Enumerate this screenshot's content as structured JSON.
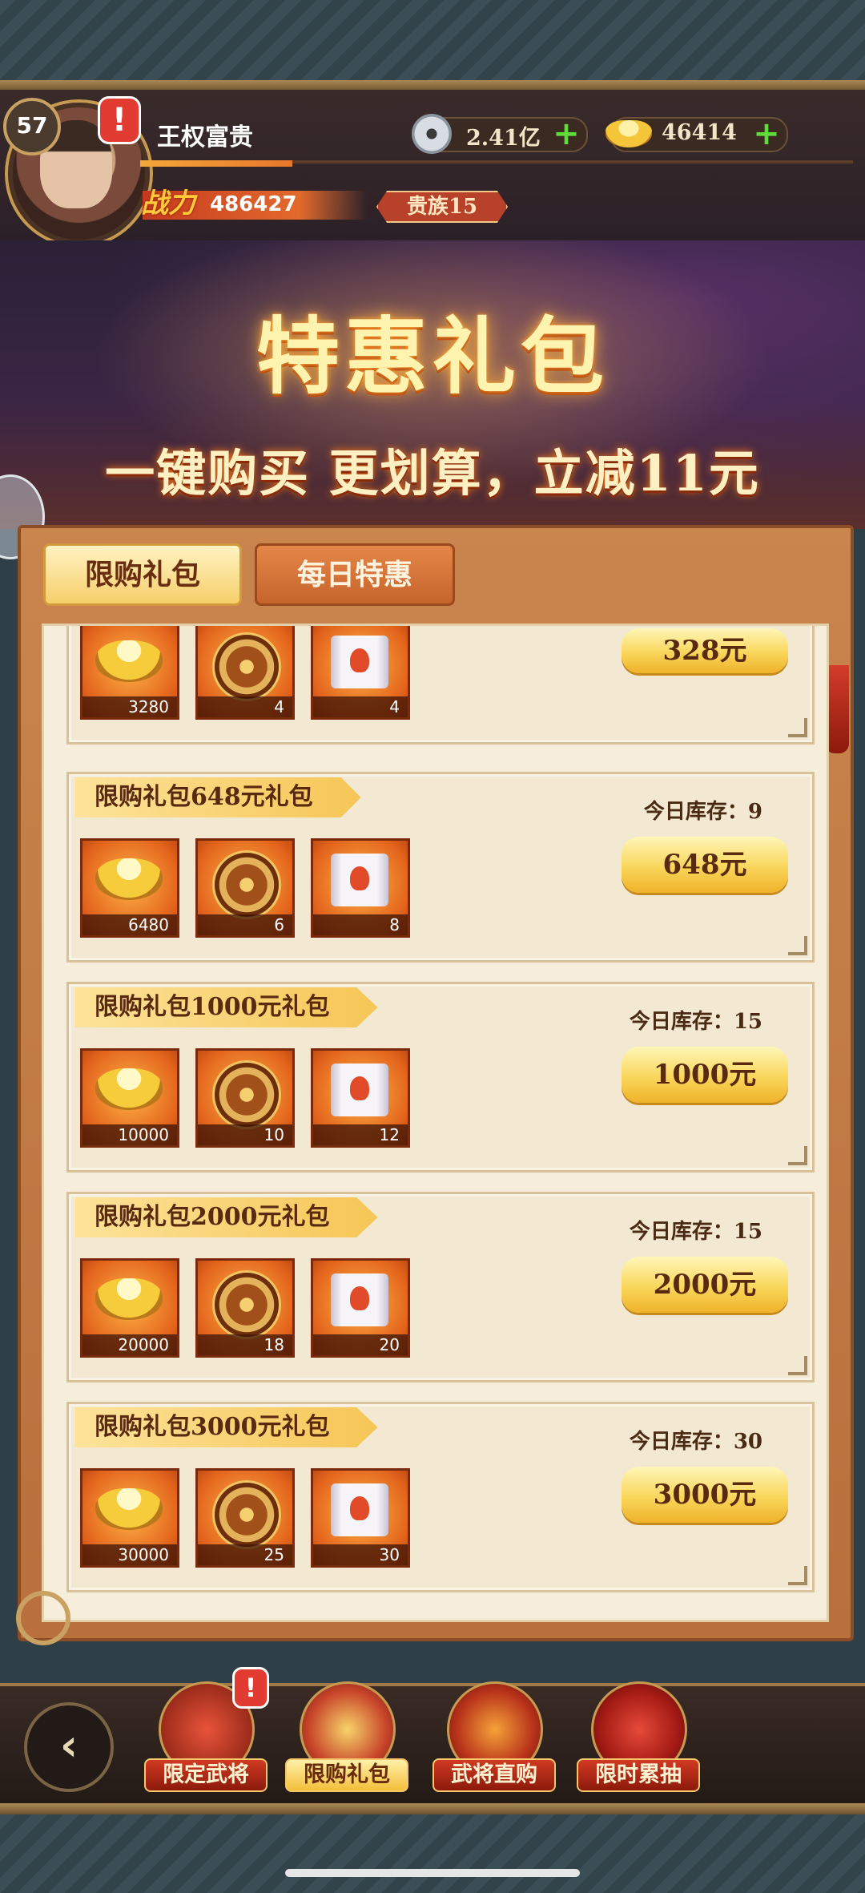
{
  "player": {
    "level": "57",
    "name": "王权富贵",
    "power_label": "战力",
    "power": "486427",
    "noble": "贵族15",
    "silver": "2.41亿",
    "gold": "46414",
    "alert": "!"
  },
  "banner": {
    "title": "特惠礼包",
    "subtitle": "一键购买 更划算，立减11元"
  },
  "tabs": [
    {
      "label": "限购礼包",
      "active": true
    },
    {
      "label": "每日特惠",
      "active": false
    }
  ],
  "packs": [
    {
      "title": "",
      "stock": "",
      "price": "328元",
      "items": [
        {
          "icon": "gold-ingot-icon",
          "count": "3280"
        },
        {
          "icon": "token-icon",
          "count": "4"
        },
        {
          "icon": "scroll-icon",
          "count": "4"
        }
      ]
    },
    {
      "title": "限购礼包648元礼包",
      "stock": "今日库存：9",
      "price": "648元",
      "items": [
        {
          "icon": "gold-ingot-icon",
          "count": "6480"
        },
        {
          "icon": "token-icon",
          "count": "6"
        },
        {
          "icon": "scroll-icon",
          "count": "8"
        }
      ]
    },
    {
      "title": "限购礼包1000元礼包",
      "stock": "今日库存：15",
      "price": "1000元",
      "items": [
        {
          "icon": "gold-ingot-icon",
          "count": "10000"
        },
        {
          "icon": "token-icon",
          "count": "10"
        },
        {
          "icon": "scroll-icon",
          "count": "12"
        }
      ]
    },
    {
      "title": "限购礼包2000元礼包",
      "stock": "今日库存：15",
      "price": "2000元",
      "items": [
        {
          "icon": "gold-ingot-icon",
          "count": "20000"
        },
        {
          "icon": "token-icon",
          "count": "18"
        },
        {
          "icon": "scroll-icon",
          "count": "20"
        }
      ]
    },
    {
      "title": "限购礼包3000元礼包",
      "stock": "今日库存：30",
      "price": "3000元",
      "items": [
        {
          "icon": "gold-ingot-icon",
          "count": "30000"
        },
        {
          "icon": "token-icon",
          "count": "25"
        },
        {
          "icon": "scroll-icon",
          "count": "30"
        }
      ]
    }
  ],
  "nav": {
    "back_icon": "back-icon",
    "items": [
      {
        "label": "限定武将",
        "icon": "general-icon",
        "badge": "!"
      },
      {
        "label": "限购礼包",
        "icon": "gift-box-icon",
        "badge": ""
      },
      {
        "label": "武将直购",
        "icon": "direct-buy-icon",
        "badge": ""
      },
      {
        "label": "限时累抽",
        "icon": "lucky-bag-icon",
        "badge": ""
      }
    ]
  },
  "colors": {
    "accent_gold": "#f6c656",
    "panel_brown": "#c9854d",
    "plus_green": "#5fdc3c",
    "alert_red": "#e23b32"
  }
}
